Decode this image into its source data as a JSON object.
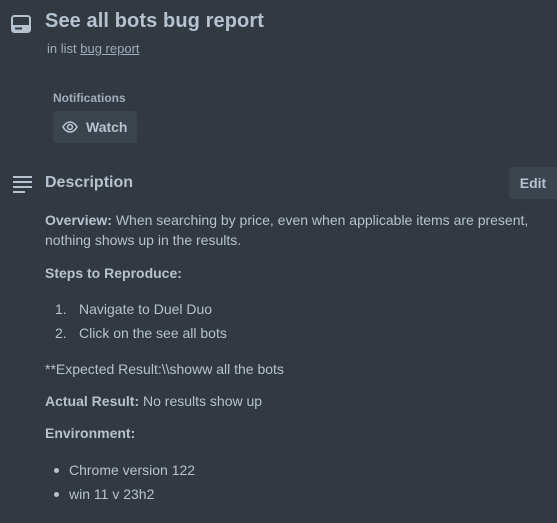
{
  "card": {
    "title": "See all bots bug report",
    "in_list_prefix": "in list",
    "list_name": "bug report"
  },
  "notifications": {
    "label": "Notifications",
    "watch_label": "Watch"
  },
  "description": {
    "heading": "Description",
    "edit_label": "Edit",
    "overview_label": "Overview:",
    "overview_text": " When searching by price, even when applicable items are present, nothing shows up in the results.",
    "steps_label": "Steps to Reproduce:",
    "steps": [
      {
        "num": "1.",
        "text": "Navigate to Duel Duo"
      },
      {
        "num": "2.",
        "text": "Click on the see all bots"
      }
    ],
    "expected_text": "**Expected Result:\\\\showw all the bots",
    "actual_label": "Actual Result:",
    "actual_text": " No results show up",
    "environment_label": "Environment:",
    "environment": [
      "Chrome version 122",
      "win 11 v 23h2"
    ]
  },
  "colors": {
    "background": "#323940",
    "text": "#b6c2cf",
    "muted_text": "#9fadbc",
    "button_bg": "#3b444c"
  },
  "icons": {
    "card": "card-icon",
    "watch": "eye-icon",
    "description": "description-lines-icon"
  }
}
